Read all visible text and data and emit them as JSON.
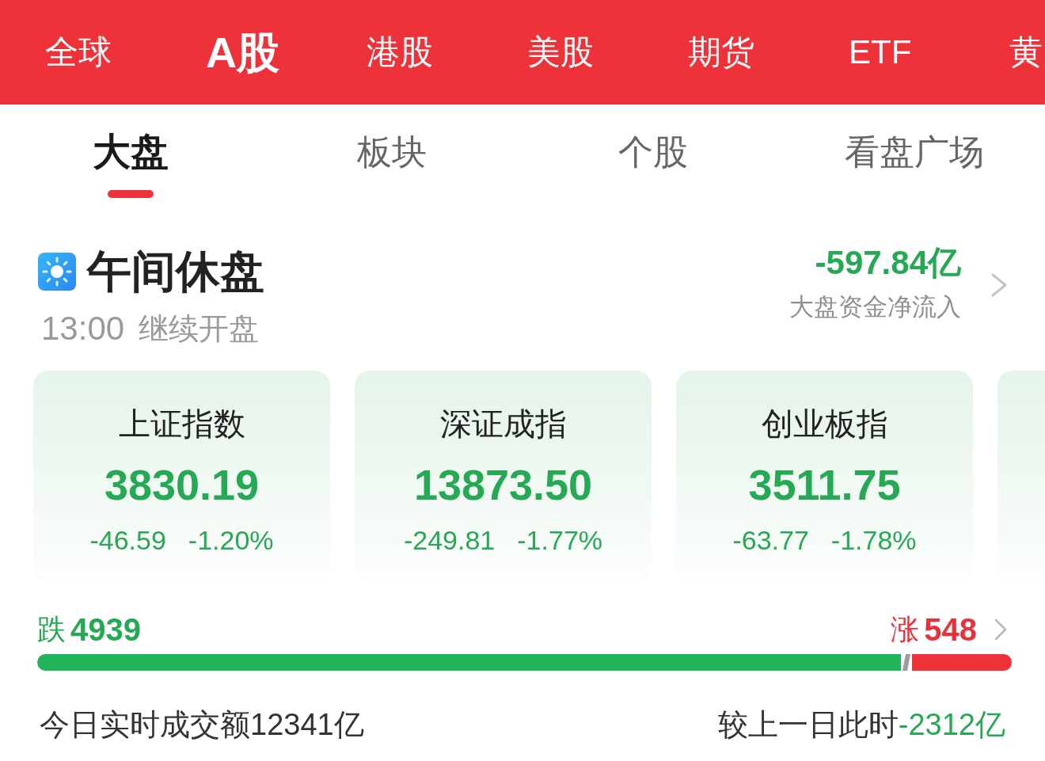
{
  "market_tabs": [
    {
      "label": "全球",
      "selected": false
    },
    {
      "label": "A股",
      "selected": true
    },
    {
      "label": "港股",
      "selected": false
    },
    {
      "label": "美股",
      "selected": false
    },
    {
      "label": "期货",
      "selected": false
    },
    {
      "label": "ETF",
      "selected": false
    },
    {
      "label": "黄",
      "selected": false
    }
  ],
  "sub_tabs": [
    {
      "label": "大盘",
      "selected": true
    },
    {
      "label": "板块",
      "selected": false
    },
    {
      "label": "个股",
      "selected": false
    },
    {
      "label": "看盘广场",
      "selected": false
    }
  ],
  "session": {
    "title": "午间休盘",
    "resume_time": "13:00",
    "resume_label": "继续开盘"
  },
  "fund_flow": {
    "value": "-597.84亿",
    "rising": false,
    "label": "大盘资金净流入"
  },
  "indices": [
    {
      "name": "上证指数",
      "value": "3830.19",
      "change": "-46.59",
      "change_pct": "-1.20%",
      "rising": false
    },
    {
      "name": "深证成指",
      "value": "13873.50",
      "change": "-249.81",
      "change_pct": "-1.77%",
      "rising": false
    },
    {
      "name": "创业板指",
      "value": "3511.75",
      "change": "-63.77",
      "change_pct": "-1.78%",
      "rising": false
    }
  ],
  "breadth": {
    "falling_label": "跌",
    "falling_count": "4939",
    "rising_label": "涨",
    "rising_count": "548",
    "level": 0.886
  },
  "turnover": {
    "text": "今日实时成交额12341亿",
    "compare_label": "较上一日此时",
    "compare_value": "-2312亿",
    "rising": false
  }
}
